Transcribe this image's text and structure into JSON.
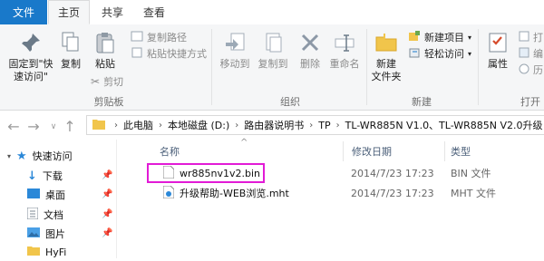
{
  "tabs": {
    "file": "文件",
    "home": "主页",
    "share": "共享",
    "view": "查看"
  },
  "ribbon": {
    "clipboard": {
      "pin_label_1": "固定到\"快",
      "pin_label_2": "速访问\"",
      "copy": "复制",
      "paste": "粘贴",
      "copy_path": "复制路径",
      "paste_shortcut": "粘贴快捷方式",
      "cut": "剪切",
      "group": "剪贴板"
    },
    "organize": {
      "move_to": "移动到",
      "copy_to": "复制到",
      "delete": "删除",
      "rename": "重命名",
      "group": "组织"
    },
    "new": {
      "new_folder_1": "新建",
      "new_folder_2": "文件夹",
      "new_item": "新建项目",
      "easy_access": "轻松访问",
      "group": "新建"
    },
    "open": {
      "properties": "属性",
      "open_cut": "打",
      "edit_cut": "编",
      "history_cut": "历",
      "group": "打开"
    }
  },
  "breadcrumb": [
    "此电脑",
    "本地磁盘 (D:)",
    "路由器说明书",
    "TP",
    "TL-WR885N V1.0、TL-WR885N V2.0升级"
  ],
  "nav": {
    "items": [
      {
        "label": "快速访问",
        "icon": "star-icon"
      },
      {
        "label": "下载",
        "icon": "download-icon"
      },
      {
        "label": "桌面",
        "icon": "desktop-icon"
      },
      {
        "label": "文档",
        "icon": "document-icon"
      },
      {
        "label": "图片",
        "icon": "pictures-icon"
      },
      {
        "label": "HyFi",
        "icon": "folder-icon"
      }
    ]
  },
  "columns": {
    "name": "名称",
    "modified": "修改日期",
    "type": "类型"
  },
  "files": [
    {
      "name": "wr885nv1v2.bin",
      "modified": "2014/7/23 17:23",
      "type": "BIN 文件"
    },
    {
      "name": "升级帮助-WEB浏览.mht",
      "modified": "2014/7/23 17:23",
      "type": "MHT 文件"
    }
  ],
  "colors": {
    "accent": "#1979ca",
    "highlight": "#e21bd6"
  }
}
